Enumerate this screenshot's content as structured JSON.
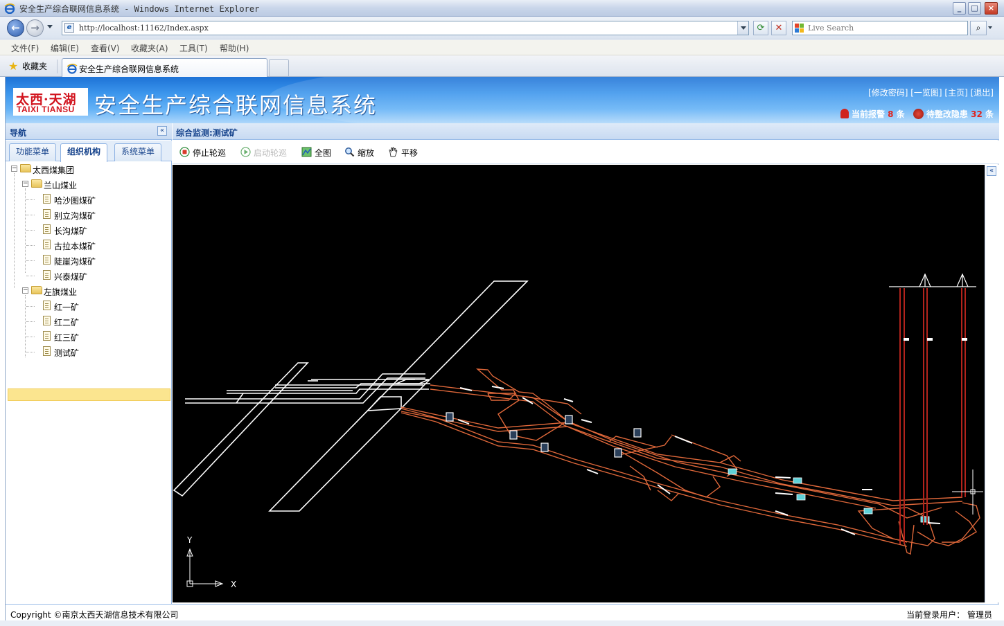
{
  "browser": {
    "window_title": "安全生产综合联网信息系统 - Windows Internet Explorer",
    "url": "http://localhost:11162/Index.aspx",
    "search_placeholder": "Live Search",
    "menu": [
      "文件(F)",
      "编辑(E)",
      "查看(V)",
      "收藏夹(A)",
      "工具(T)",
      "帮助(H)"
    ],
    "favorites_label": "收藏夹",
    "tab_title": "安全生产综合联网信息系统",
    "minimize": "_",
    "maximize": "□",
    "close": "×"
  },
  "header": {
    "logo_cn": "太西·天湖",
    "logo_en": "TAIXI TIANSU",
    "system_title": "安全生产综合联网信息系统",
    "links": [
      "[修改密码]",
      "[一览图]",
      "[主页]",
      "[退出]"
    ],
    "alarm_label": "当前报警",
    "alarm_count": "8",
    "alarm_unit": "条",
    "hazard_label": "待整改隐患",
    "hazard_count": "32",
    "hazard_unit": "条"
  },
  "nav": {
    "title": "导航",
    "collapse": "«",
    "tabs": [
      "功能菜单",
      "组织机构",
      "系统菜单"
    ],
    "active_tab": "组织机构",
    "tree": {
      "root": "太西煤集团",
      "groups": [
        {
          "name": "兰山煤业",
          "items": [
            "哈沙图煤矿",
            "别立沟煤矿",
            "长沟煤矿",
            "古拉本煤矿",
            "陡崖沟煤矿",
            "兴泰煤矿"
          ]
        },
        {
          "name": "左旗煤业",
          "items": [
            "红一矿",
            "红二矿",
            "红三矿",
            "测试矿"
          ]
        }
      ],
      "selected": "测试矿"
    }
  },
  "main": {
    "title": "综合监测:测试矿",
    "tools": [
      "停止轮巡",
      "启动轮巡",
      "全图",
      "缩放",
      "平移"
    ],
    "axis_y": "Y",
    "axis_x": "X"
  },
  "status": {
    "copyright": "Copyright ©南京太西天湖信息技术有限公司",
    "user_label": "当前登录用户：",
    "user_name": "管理员"
  },
  "colors": {
    "header_blue": "#3b95ec",
    "panel_border": "#99bbe8",
    "selection": "#fbe58f",
    "tunnel_orange": "#e0683a",
    "shaft_red": "#b3231c"
  }
}
